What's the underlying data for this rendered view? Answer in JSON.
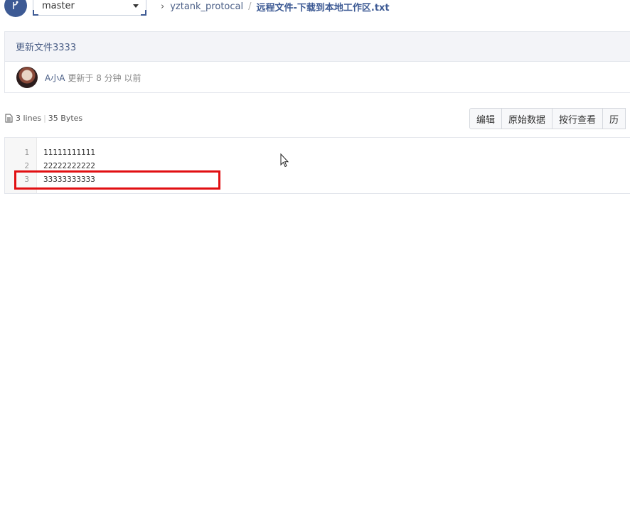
{
  "branch": {
    "label": "master"
  },
  "breadcrumb": {
    "repo": "yztank_protocal",
    "separator": "/",
    "file": "远程文件-下载到本地工作区.txt"
  },
  "commit": {
    "message": "更新文件3333",
    "author": "A小A",
    "updated": "更新于 8 分钟 以前"
  },
  "file_info": {
    "lines": "3 lines",
    "size": "35 Bytes"
  },
  "toolbar": {
    "edit_label": "编辑",
    "raw_label": "原始数据",
    "blame_label": "按行查看",
    "history_label": "历"
  },
  "code": {
    "lines": [
      {
        "number": "1",
        "text": "11111111111"
      },
      {
        "number": "2",
        "text": "22222222222"
      },
      {
        "number": "3",
        "text": "33333333333"
      }
    ]
  },
  "colors": {
    "brand": "#3d5a94",
    "link": "#4a5e86",
    "highlight_border": "#e10f12"
  }
}
